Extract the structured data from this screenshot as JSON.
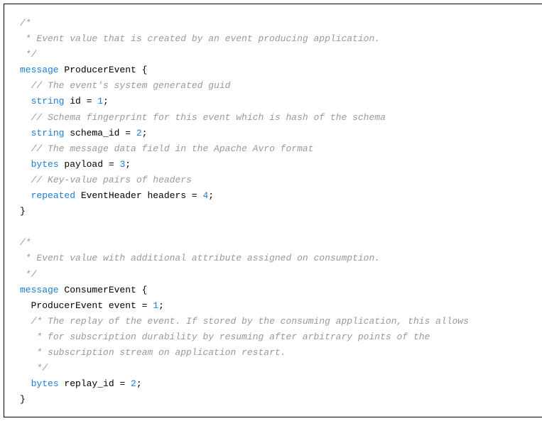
{
  "code": {
    "lines": [
      {
        "indent": 0,
        "tokens": [
          {
            "class": "comment",
            "text": "/*"
          }
        ]
      },
      {
        "indent": 0,
        "tokens": [
          {
            "class": "comment",
            "text": " * Event value that is created by an event producing application."
          }
        ]
      },
      {
        "indent": 0,
        "tokens": [
          {
            "class": "comment",
            "text": " */"
          }
        ]
      },
      {
        "indent": 0,
        "tokens": [
          {
            "class": "keyword",
            "text": "message"
          },
          {
            "class": "identifier",
            "text": " ProducerEvent {"
          }
        ]
      },
      {
        "indent": 1,
        "tokens": [
          {
            "class": "comment",
            "text": "// The event's system generated guid"
          }
        ]
      },
      {
        "indent": 1,
        "tokens": [
          {
            "class": "type",
            "text": "string"
          },
          {
            "class": "identifier",
            "text": " id = "
          },
          {
            "class": "number",
            "text": "1"
          },
          {
            "class": "identifier",
            "text": ";"
          }
        ]
      },
      {
        "indent": 1,
        "tokens": [
          {
            "class": "comment",
            "text": "// Schema fingerprint for this event which is hash of the schema"
          }
        ]
      },
      {
        "indent": 1,
        "tokens": [
          {
            "class": "type",
            "text": "string"
          },
          {
            "class": "identifier",
            "text": " schema_id = "
          },
          {
            "class": "number",
            "text": "2"
          },
          {
            "class": "identifier",
            "text": ";"
          }
        ]
      },
      {
        "indent": 1,
        "tokens": [
          {
            "class": "comment",
            "text": "// The message data field in the Apache Avro format"
          }
        ]
      },
      {
        "indent": 1,
        "tokens": [
          {
            "class": "type",
            "text": "bytes"
          },
          {
            "class": "identifier",
            "text": " payload = "
          },
          {
            "class": "number",
            "text": "3"
          },
          {
            "class": "identifier",
            "text": ";"
          }
        ]
      },
      {
        "indent": 1,
        "tokens": [
          {
            "class": "comment",
            "text": "// Key-value pairs of headers"
          }
        ]
      },
      {
        "indent": 1,
        "tokens": [
          {
            "class": "keyword",
            "text": "repeated"
          },
          {
            "class": "identifier",
            "text": " EventHeader headers = "
          },
          {
            "class": "number",
            "text": "4"
          },
          {
            "class": "identifier",
            "text": ";"
          }
        ]
      },
      {
        "indent": 0,
        "tokens": [
          {
            "class": "identifier",
            "text": "}"
          }
        ]
      },
      {
        "indent": 0,
        "tokens": [
          {
            "class": "identifier",
            "text": ""
          }
        ]
      },
      {
        "indent": 0,
        "tokens": [
          {
            "class": "comment",
            "text": "/*"
          }
        ]
      },
      {
        "indent": 0,
        "tokens": [
          {
            "class": "comment",
            "text": " * Event value with additional attribute assigned on consumption."
          }
        ]
      },
      {
        "indent": 0,
        "tokens": [
          {
            "class": "comment",
            "text": " */"
          }
        ]
      },
      {
        "indent": 0,
        "tokens": [
          {
            "class": "keyword",
            "text": "message"
          },
          {
            "class": "identifier",
            "text": " ConsumerEvent {"
          }
        ]
      },
      {
        "indent": 1,
        "tokens": [
          {
            "class": "identifier",
            "text": "ProducerEvent event = "
          },
          {
            "class": "number",
            "text": "1"
          },
          {
            "class": "identifier",
            "text": ";"
          }
        ]
      },
      {
        "indent": 1,
        "tokens": [
          {
            "class": "comment",
            "text": "/* The replay of the event. If stored by the consuming application, this allows"
          }
        ]
      },
      {
        "indent": 1,
        "tokens": [
          {
            "class": "comment",
            "text": " * for subscription durability by resuming after arbitrary points of the"
          }
        ]
      },
      {
        "indent": 1,
        "tokens": [
          {
            "class": "comment",
            "text": " * subscription stream on application restart."
          }
        ]
      },
      {
        "indent": 1,
        "tokens": [
          {
            "class": "comment",
            "text": " */"
          }
        ]
      },
      {
        "indent": 1,
        "tokens": [
          {
            "class": "type",
            "text": "bytes"
          },
          {
            "class": "identifier",
            "text": " replay_id = "
          },
          {
            "class": "number",
            "text": "2"
          },
          {
            "class": "identifier",
            "text": ";"
          }
        ]
      },
      {
        "indent": 0,
        "tokens": [
          {
            "class": "identifier",
            "text": "}"
          }
        ]
      }
    ]
  }
}
